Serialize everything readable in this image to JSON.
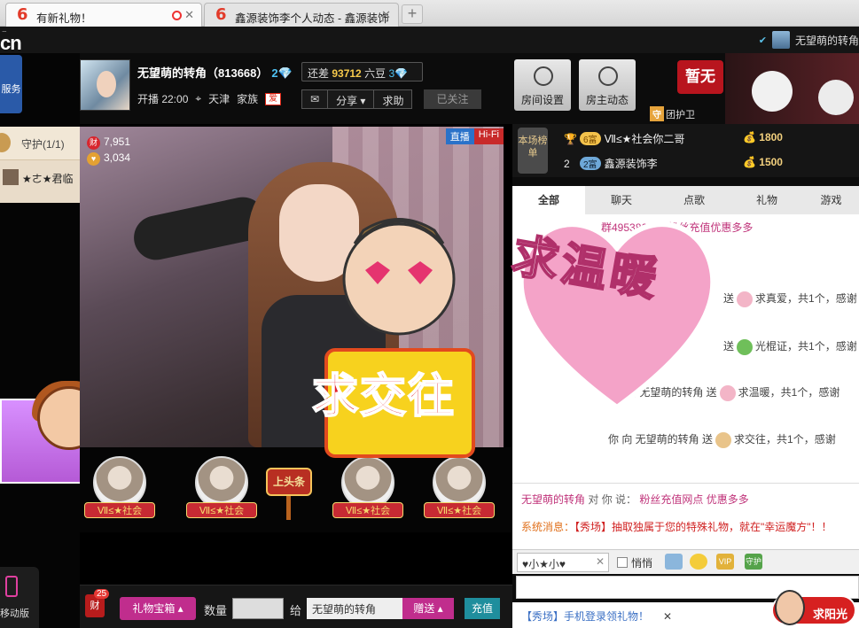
{
  "browser": {
    "tabs": [
      {
        "title": "有新礼物！",
        "active": true
      },
      {
        "title": "鑫源装饰李个人动态 - 鑫源装饰",
        "active": false
      }
    ],
    "new_tab": "+"
  },
  "site": {
    "logo_text": "cn"
  },
  "top_user": {
    "name": "无望萌的转角"
  },
  "left": {
    "service_label": "服务",
    "guard_title": "守护(1/1)",
    "guard_user": "★ㄜ★君临",
    "mobile_label": "移动版"
  },
  "anchor": {
    "name": "无望萌的转角（813668）",
    "level_num": "2",
    "need_prefix": "还差",
    "need_value": "93712",
    "need_suffix": "六豆",
    "need_level": "3",
    "start_time": "开播 22:00",
    "city": "天津",
    "family_label": "家族",
    "family_badge": "爱",
    "share_label": "分享",
    "help_label": "求助",
    "followed_label": "已关注"
  },
  "video": {
    "wealth_count": "7,951",
    "fan_count": "3,034",
    "live_badge": "直播",
    "hifi_badge": "Hi-Fi",
    "wealth_icon": "财"
  },
  "overlay": {
    "heart_text": "求温暖",
    "sign_text": "求交往"
  },
  "gift_row": {
    "tags": [
      "Ⅶ≤★社会",
      "Ⅶ≤★社会",
      "Ⅶ≤★社会",
      "Ⅶ≤★社会"
    ],
    "headline": "上头条"
  },
  "gift_bar": {
    "cai_label": "财",
    "cai_count": "25",
    "giftbox": "礼物宝箱",
    "qty_label": "数量",
    "to_label": "给",
    "recipient": "无望萌的转角",
    "send": "赠送",
    "recharge": "充值"
  },
  "right": {
    "room_settings": "房间设置",
    "host_feed": "房主动态",
    "guardian": "团护卫",
    "guardian_icon": "守",
    "nobody": "暂无",
    "rank_title": "本场榜单",
    "rank": [
      {
        "pos": "1",
        "level": "6富",
        "name": "Ⅶ≤★社会你二哥",
        "score": "1800"
      },
      {
        "pos": "2",
        "level": "2富",
        "name": "鑫源装饰李",
        "score": "1500"
      }
    ],
    "chat_tabs": [
      "全部",
      "聊天",
      "点歌",
      "礼物",
      "游戏"
    ],
    "chat_top": "群495386093 粉丝充值优惠多多",
    "chat_lines": [
      {
        "pre": "送",
        "gift": "求真爱，共1个，感谢"
      },
      {
        "pre": "送",
        "gift": "光棍证，共1个，感谢"
      },
      {
        "pre": "向 无望萌的转角 送",
        "gift": "求温暖，共1个，感谢"
      },
      {
        "pre": "你 向 无望萌的转角 送",
        "gift": "求交往，共1个，感谢"
      }
    ],
    "sys_line1_name": "无望萌的转角",
    "sys_line1_mid": "对 你 说：",
    "sys_line1_msg": "粉丝充值网点 优惠多多",
    "sys_line2_label": "系统消息：",
    "sys_line2_msg": "【秀场】抽取独属于您的特殊礼物，就在\"幸运魔方\"！！",
    "whisper_target": "♥小★小♥",
    "quiet_label": "悄悄",
    "vip_label": "VIP",
    "guard_icon_label": "守护",
    "bottom_msg": "【秀场】手机登录领礼物！",
    "send_button": "求阳光"
  },
  "colors": {
    "accent_pink": "#c02d8d",
    "rank_gold": "#f3c24b",
    "hifi_red": "#c82a2a",
    "live_blue": "#2a72c9"
  }
}
